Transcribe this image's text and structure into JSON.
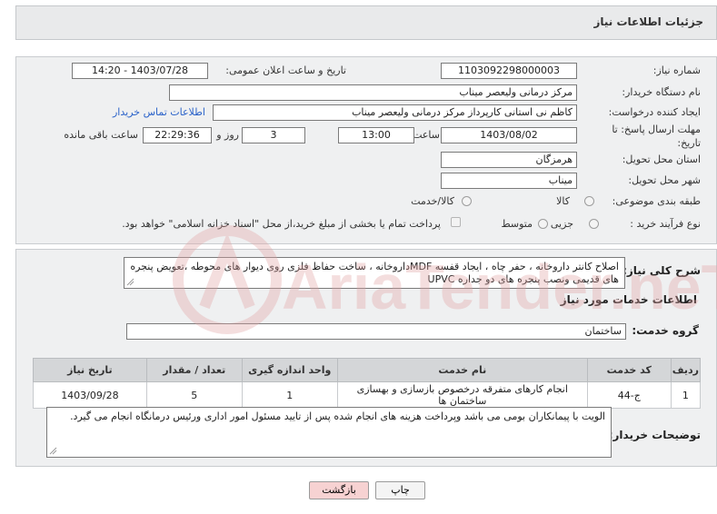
{
  "header": {
    "title": "جزئیات اطلاعات نیاز"
  },
  "form": {
    "need_number": {
      "label": "شماره نیاز:",
      "value": "1103092298000003"
    },
    "announce_datetime": {
      "label": "تاریخ و ساعت اعلان عمومی:",
      "value": "1403/07/28 - 14:20"
    },
    "buyer_org": {
      "label": "نام دستگاه خریدار:",
      "value": "مرکز درمانی ولیعصر میناب"
    },
    "requester": {
      "label": "ایجاد کننده درخواست:",
      "value": "کاظم نی استانی کارپرداز مرکز درمانی ولیعصر میناب",
      "contact_link": "اطلاعات تماس خریدار"
    },
    "deadline": {
      "label_line1": "مهلت ارسال پاسخ: تا",
      "label_line2": "تاریخ:",
      "date": "1403/08/02",
      "time_label": "ساعت",
      "time": "13:00",
      "days": "3",
      "days_label": "روز و",
      "remaining": "22:29:36",
      "remaining_label": "ساعت باقی مانده"
    },
    "province": {
      "label": "استان محل تحویل:",
      "value": "هرمزگان"
    },
    "city": {
      "label": "شهر محل تحویل:",
      "value": "میناب"
    },
    "category": {
      "label": "طبقه بندی موضوعی:",
      "options": [
        "کالا",
        "کالا/خدمت"
      ]
    },
    "process": {
      "label": "نوع فرآیند خرید :",
      "options": [
        "جزیی",
        "متوسط"
      ],
      "treasury_note": "پرداخت تمام یا بخشی از مبلغ خرید،از محل \"اسناد خزانه اسلامی\" خواهد بود."
    }
  },
  "summary": {
    "label": "شرح کلی نیاز:",
    "text": "اصلاح کانتر داروخانه ، حفر چاه ، ایجاد قفسه MDFداروخانه    ، ساخت حفاظ فلزی روی دیوار های محوطه ،تعویض پنجره های قدیمی ونصب پنجره های دو جداره UPVC"
  },
  "services": {
    "section_title": "اطلاعات خدمات مورد نیاز",
    "group_label": "گروه خدمت:",
    "group_value": "ساختمان",
    "table": {
      "headers": [
        "ردیف",
        "کد خدمت",
        "نام خدمت",
        "واحد اندازه گیری",
        "تعداد / مقدار",
        "تاریخ نیاز"
      ],
      "rows": [
        [
          "1",
          "ج-44",
          "انجام کارهای متفرقه درخصوص بازسازی و بهسازی ساختمان ها",
          "1",
          "5",
          "1403/09/28"
        ]
      ]
    }
  },
  "buyer_notes": {
    "label": "توضیحات خریدار:",
    "text": "الویت با پیمانکاران بومی می باشد وپرداخت هزینه های انجام شده پس از تایید مسئول امور اداری ورئیس درمانگاه انجام می گیرد."
  },
  "buttons": {
    "print": "چاپ",
    "back": "بازگشت"
  },
  "watermark_text": "AriaTender.neT",
  "colors": {
    "back_button_bg": "#f7d2d2",
    "link": "#2a62c9",
    "watermark": "#e7b3b3"
  }
}
